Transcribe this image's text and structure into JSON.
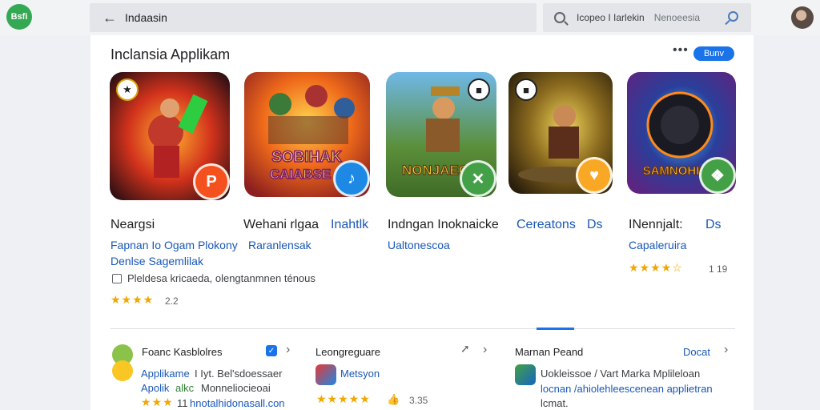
{
  "header": {
    "logo": "Bsfi",
    "nav_title": "Indaasin",
    "back_icon": "arrow-left-icon",
    "search_query": "Icopeo I Iarlekin",
    "search_hint": "Nenoeesia"
  },
  "section": {
    "title": "Inclansia Applikam",
    "more_label": "Bunv"
  },
  "apps": [
    {
      "name": "Neargsi",
      "sub1": "Fapnan Io Ogam Plokony",
      "sub2": "Denlse Sagemlilak",
      "meta": "Pleldesa kricaeda, olengtanmnen ténous",
      "stars": "★★★★",
      "rating": "2.2",
      "icon_title": "",
      "badge_icon": "chat-bubble-icon",
      "badge_color": "#f4511e"
    },
    {
      "name": "Wehani rlgaa",
      "name2": "Inahtlk",
      "sub1": "Raranlensak",
      "icon_title": "SOBIHAK CAIABSE",
      "badge_icon": "tiktok-note-icon",
      "badge_color": "#1e88e5"
    },
    {
      "name": "Indngan Inoknaicke",
      "sub1": "Ualtonescoa",
      "icon_title": "NONJAEO",
      "badge_icon": "xbox-icon",
      "badge_color": "#43a047"
    },
    {
      "name": "Cereatons",
      "name2": "Ds",
      "badge_icon": "heart-icon",
      "badge_color": "#f9a825"
    },
    {
      "name": "INennjalt:",
      "name2": "Ds",
      "sub1": "Capaleruira",
      "stars": "★★★★☆",
      "rating": "1 19",
      "icon_title": "SAMNOHIS",
      "badge_icon": "gamepad-icon",
      "badge_color": "#43a047"
    }
  ],
  "bottom": [
    {
      "title": "Foanc Kasblolres",
      "item": "Applikame",
      "item_rest": "I Iyt. Bel'sdoessaer",
      "line2a": "Apolik",
      "line2b": "alkc",
      "line2c": "Monneliocieoai",
      "stars": "★★★",
      "line3": "11",
      "link": "hnotalhidonasall.con"
    },
    {
      "title": "Leongreguare",
      "item": "Metsyon",
      "stars": "★★★★★",
      "rating": "3.35"
    },
    {
      "title": "Marnan Peand",
      "action": "Docat",
      "text1": "Uokleissoe / Vart Marka Mplileloan",
      "text2": "locnan /ahiolehleescenean applietran",
      "text3": "lcmat."
    }
  ]
}
